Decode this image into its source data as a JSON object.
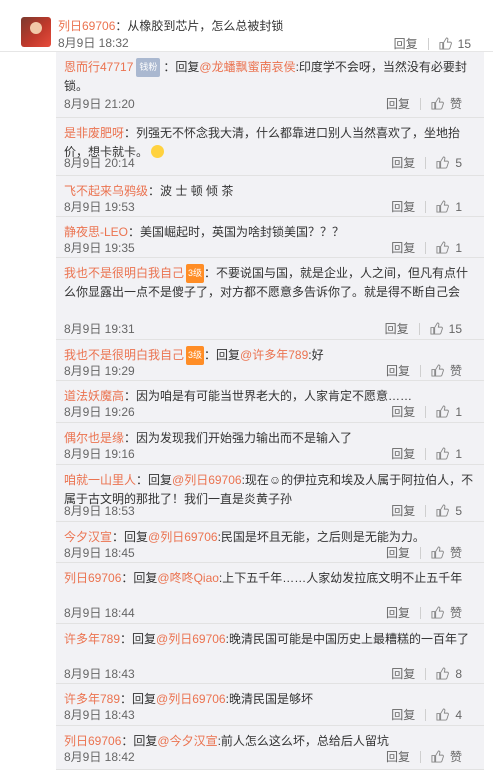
{
  "main": {
    "user": "列日69706",
    "text": "：从橡胶到芯片，怎么总被封锁",
    "date": "8月9日 18:32",
    "reply": "回复",
    "likes": "15"
  },
  "replies": [
    {
      "user": "恩而行47717",
      "badge": "钱粉",
      "pre": "：回复",
      "mention": "@龙蟠飘蜜南哀侯",
      "text": ":印度学不会呀，当然没有必要封锁。",
      "date": "8月9日 21:20",
      "reply": "回复",
      "likes": "赞"
    },
    {
      "user": "是非废肥呀",
      "pre": "：",
      "text": "列强无不怀念我大清，什么都靠进口别人当然喜欢了，坐地抬价，想卡就卡。",
      "date": "8月9日 20:14",
      "reply": "回复",
      "likes": "5"
    },
    {
      "user": "飞不起来乌鸦级",
      "pre": "：",
      "text": "波 士 顿 倾 茶",
      "date": "8月9日 19:53",
      "reply": "回复",
      "likes": "1"
    },
    {
      "user": "静夜思-LEO",
      "pre": "：",
      "text": "美国崛起时，英国为啥封锁美国？？？",
      "date": "8月9日 19:35",
      "reply": "回复",
      "likes": "1"
    },
    {
      "user": "我也不是很明白我自己",
      "badge": "3级",
      "pre": "：",
      "text": "不要说国与国，就是企业，人之间，但凡有点什么你显露出一点不是傻子了，对方都不愿意多告诉你了。就是得不断自己会",
      "date": "8月9日 19:31",
      "reply": "回复",
      "likes": "15"
    },
    {
      "user": "我也不是很明白我自己",
      "badge": "3级",
      "pre": "：回复",
      "mention": "@许多年789",
      "text": ":好",
      "date": "8月9日 19:29",
      "reply": "回复",
      "likes": "赞"
    },
    {
      "user": "道法妖魔高",
      "pre": "：",
      "text": "因为咱是有可能当世界老大的，人家肯定不愿意……",
      "date": "8月9日 19:26",
      "reply": "回复",
      "likes": "1"
    },
    {
      "user": "偶尔也是缘",
      "pre": "：",
      "text": "因为发现我们开始强力输出而不是输入了",
      "date": "8月9日 19:16",
      "reply": "回复",
      "likes": "1"
    },
    {
      "user": "咱就一山里人",
      "pre": "：回复",
      "mention": "@列日69706",
      "text": ":现在☺的伊拉克和埃及人属于阿拉伯人，不属于古文明的那批了！我们一直是炎黄子孙",
      "date": "8月9日 18:53",
      "reply": "回复",
      "likes": "5"
    },
    {
      "user": "今夕汉宣",
      "pre": "：回复",
      "mention": "@列日69706",
      "text": ":民国是坏且无能，之后则是无能为力。",
      "date": "8月9日 18:45",
      "reply": "回复",
      "likes": "赞"
    },
    {
      "user": "列日69706",
      "pre": "：回复",
      "mention": "@咚咚Qiao",
      "text": ":上下五千年……人家幼发拉底文明不止五千年",
      "date": "8月9日 18:44",
      "reply": "回复",
      "likes": "赞"
    },
    {
      "user": "许多年789",
      "pre": "：回复",
      "mention": "@列日69706",
      "text": ":晚清民国可能是中国历史上最糟糕的一百年了",
      "date": "8月9日 18:43",
      "reply": "回复",
      "likes": "8"
    },
    {
      "user": "许多年789",
      "pre": "：回复",
      "mention": "@列日69706",
      "text": ":晚清民国是够坏",
      "date": "8月9日 18:43",
      "reply": "回复",
      "likes": "4"
    },
    {
      "user": "列日69706",
      "pre": "：回复",
      "mention": "@今夕汉宣",
      "text": ":前人怎么这么坏，总给后人留坑",
      "date": "8月9日 18:42",
      "reply": "回复",
      "likes": "赞"
    }
  ],
  "icons": {
    "like": "thumbs-up-icon",
    "emoji": "smile-emoji-icon"
  },
  "colors": {
    "link": "#eb7350",
    "panel_bg": "#f2f2f5",
    "text": "#333333",
    "meta": "#666666"
  }
}
